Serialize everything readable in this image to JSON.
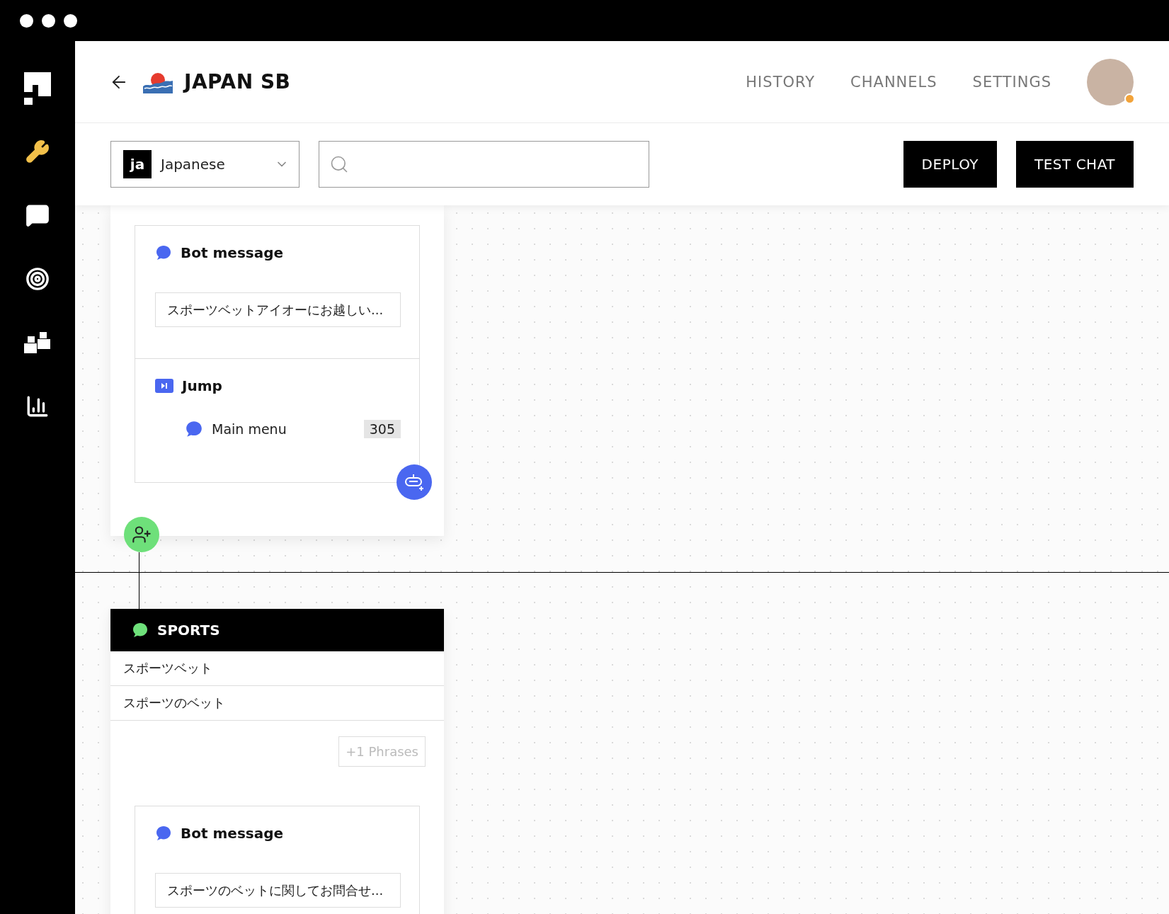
{
  "sidebar": {
    "items": [
      {
        "kind": "tools",
        "selected": true
      },
      {
        "kind": "chat",
        "selected": false
      },
      {
        "kind": "target",
        "selected": false
      },
      {
        "kind": "blocks",
        "selected": false
      },
      {
        "kind": "stats",
        "selected": false
      }
    ]
  },
  "header": {
    "title": "JAPAN SB",
    "nav": [
      "HISTORY",
      "CHANNELS",
      "SETTINGS"
    ],
    "user": {
      "online": true
    }
  },
  "toolbar": {
    "language": {
      "code": "ja",
      "label": "Japanese"
    },
    "buttons": [
      "DEPLOY",
      "TEST CHAT"
    ]
  },
  "canvas": {
    "nodes": [
      {
        "kind": "flow",
        "steps": [
          {
            "kind": "bot_message",
            "title": "Bot message",
            "text": "スポーツベットアイオーにお越しい..."
          },
          {
            "kind": "jump",
            "title": "Jump",
            "target": "Main menu",
            "count": "305"
          }
        ]
      },
      {
        "kind": "intent",
        "title": "SPORTS",
        "phrases": [
          "スポーツベット",
          "スポーツのベット"
        ],
        "more": "+1 Phrases",
        "steps": [
          {
            "kind": "bot_message",
            "title": "Bot message",
            "text": "スポーツのベットに関してお問合せ..."
          }
        ]
      }
    ]
  }
}
